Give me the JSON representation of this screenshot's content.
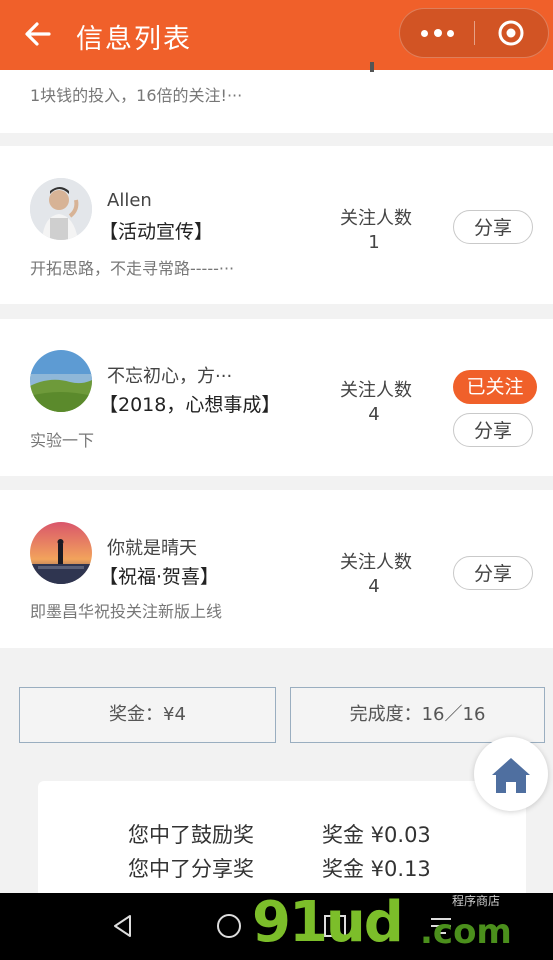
{
  "header": {
    "title": "信息列表",
    "back_icon": "arrow-left-icon",
    "more_icon": "more-dots-icon",
    "close_icon": "target-circle-icon"
  },
  "colors": {
    "accent": "#f0602a",
    "header_bg": "#f0602a",
    "page_bg": "#f2f2f2"
  },
  "cards": [
    {
      "desc": "1块钱的投入，16倍的关注!···"
    },
    {
      "name": "Allen",
      "tag": "【活动宣传】",
      "desc": "开拓思路，不走寻常路-----···",
      "follow_label": "关注人数",
      "follow_count": "1",
      "share_label": "分享"
    },
    {
      "name": "不忘初心，方···",
      "tag": "【2018，心想事成】",
      "desc": "实验一下",
      "follow_label": "关注人数",
      "follow_count": "4",
      "followed_label": "已关注",
      "share_label": "分享"
    },
    {
      "name": "你就是晴天",
      "tag": "【祝福·贺喜】",
      "desc": "即墨昌华祝投关注新版上线",
      "follow_label": "关注人数",
      "follow_count": "4",
      "share_label": "分享"
    }
  ],
  "stats": {
    "bonus": "奖金：¥4",
    "completion": "完成度：16／16"
  },
  "home_icon": "home-icon",
  "prizes": [
    {
      "label": "您中了鼓励奖",
      "amount": "奖金 ¥0.03"
    },
    {
      "label": "您中了分享奖",
      "amount": "奖金 ¥0.13"
    }
  ],
  "navbar": {
    "icons": [
      "back-triangle-icon",
      "home-circle-icon",
      "recent-square-icon",
      "menu-icon"
    ]
  },
  "watermark": {
    "text1": "91ud",
    "text2": ".com",
    "small": "程序商店"
  }
}
